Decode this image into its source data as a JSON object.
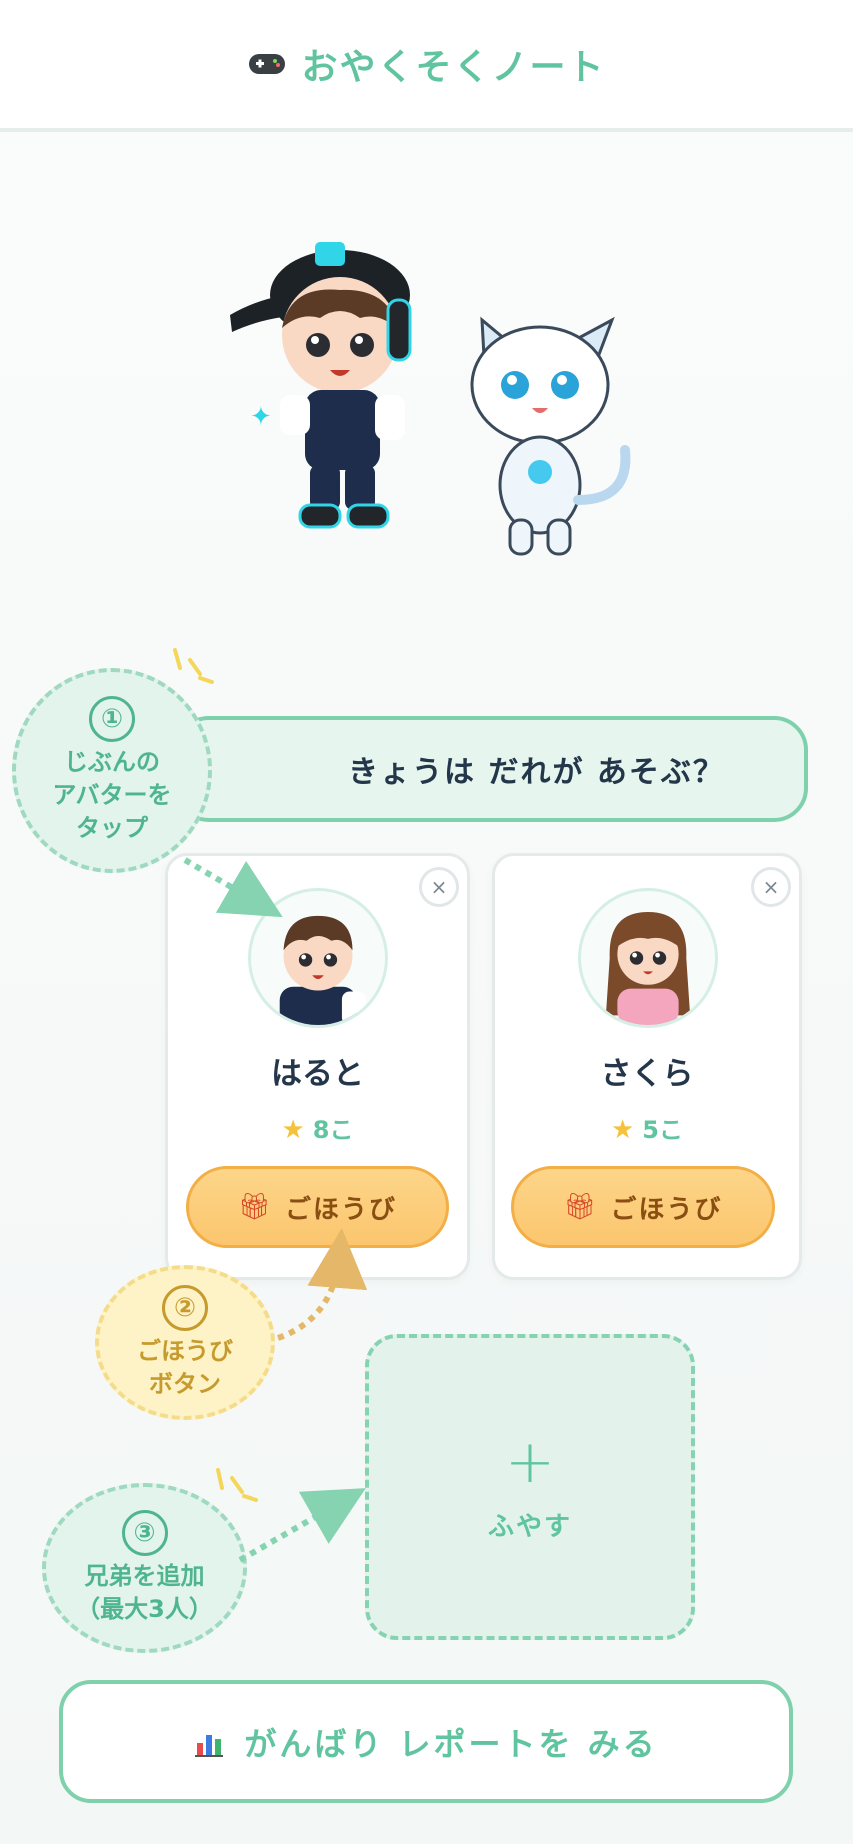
{
  "header": {
    "title": "おやくそくノート",
    "icon": "gamepad-icon"
  },
  "banner": {
    "text": "きょうは だれが あそぶ？"
  },
  "callouts": [
    {
      "number": "①",
      "lines": [
        "じぶんの",
        "アバターを",
        "タップ"
      ]
    },
    {
      "number": "②",
      "lines": [
        "ごほうび",
        "ボタン"
      ]
    },
    {
      "number": "③",
      "lines": [
        "兄弟を追加",
        "（最大3人）"
      ]
    }
  ],
  "profiles": [
    {
      "name": "はると",
      "stars": "8こ",
      "reward_label": "ごほうび",
      "close": "×"
    },
    {
      "name": "さくら",
      "stars": "5こ",
      "reward_label": "ごほうび",
      "close": "×"
    }
  ],
  "add_tile": {
    "plus": "+",
    "label": "ふやす"
  },
  "report_button": {
    "label": "がんばり レポートを みる",
    "icon": "bar-chart-icon"
  },
  "colors": {
    "accent": "#5fc49f",
    "accent_border": "#7fd0ad",
    "reward": "#fbc66e",
    "text": "#24364a"
  }
}
